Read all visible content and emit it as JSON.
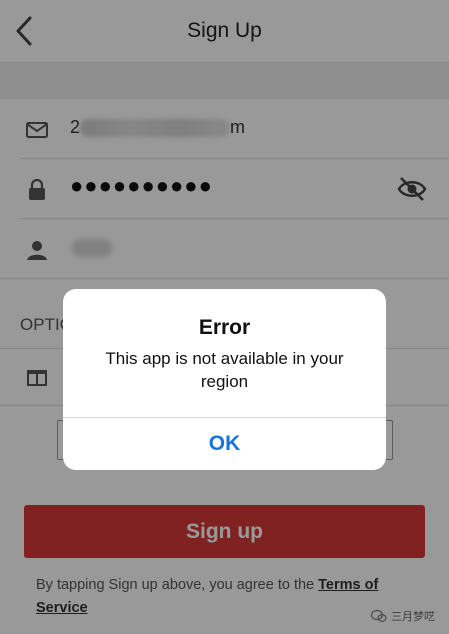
{
  "header": {
    "title": "Sign Up",
    "back_icon": "chevron-left-icon"
  },
  "form": {
    "email": {
      "icon": "mail-icon",
      "visible_prefix": "2",
      "visible_suffix": "m"
    },
    "password": {
      "icon": "lock-icon",
      "masked_value": "●●●●●●●●●●",
      "toggle_icon": "eye-off-icon"
    },
    "name": {
      "icon": "person-icon"
    },
    "optional_label": "OPTIC",
    "gift_icon": "gift-icon"
  },
  "signup_button": {
    "label": "Sign up",
    "color": "#d53a37"
  },
  "terms": {
    "prefix": "By tapping Sign up above, you agree to the ",
    "link": "Terms of Service"
  },
  "alert": {
    "title": "Error",
    "message": "This app is not available in your region",
    "ok_label": "OK",
    "ok_color": "#1a73d9"
  },
  "watermark": {
    "text": "三月梦呓"
  }
}
